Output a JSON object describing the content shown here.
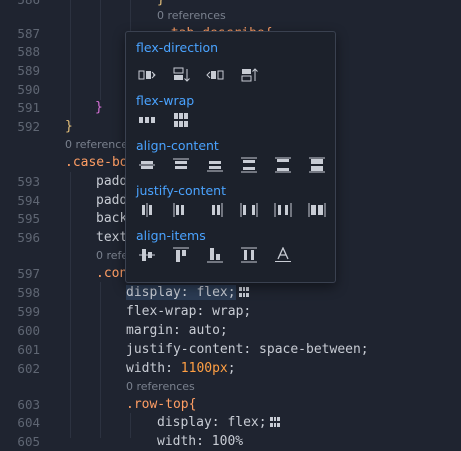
{
  "editor": {
    "lines": [
      {
        "n": "586",
        "code": "}",
        "partial": true
      },
      {
        "n": "",
        "ref": "0 references"
      },
      {
        "n": "587",
        "code": ".tab-describe{"
      },
      {
        "n": "588",
        "code": ""
      },
      {
        "n": "589",
        "code": ""
      },
      {
        "n": "590",
        "code": ""
      },
      {
        "n": "591",
        "code": "}"
      },
      {
        "n": "592",
        "code": "}"
      },
      {
        "n": "",
        "ref": "0 references"
      },
      {
        "n": "",
        "code": ".case-bo"
      },
      {
        "n": "593",
        "code": "padd"
      },
      {
        "n": "594",
        "code": "padd"
      },
      {
        "n": "595",
        "code": "back"
      },
      {
        "n": "596",
        "code": "text"
      },
      {
        "n": "",
        "ref": "0 refe"
      },
      {
        "n": "597",
        "code": ".con"
      },
      {
        "n": "598",
        "code": "display: flex;"
      },
      {
        "n": "599",
        "code": "flex-wrap: wrap;"
      },
      {
        "n": "600",
        "code": "margin: auto;"
      },
      {
        "n": "601",
        "code": "justify-content: space-between;"
      },
      {
        "n": "602",
        "code_pre": "width: ",
        "num": "1100px",
        "code_post": ";"
      },
      {
        "n": "603",
        "code": ""
      },
      {
        "n": "",
        "ref": "0 references"
      },
      {
        "n": "604",
        "code": ".row-top{"
      },
      {
        "n": "605",
        "code": "display: flex;"
      }
    ],
    "line_numbers": [
      "586",
      "587",
      "588",
      "589",
      "590",
      "591",
      "592",
      "593",
      "594",
      "595",
      "596",
      "597",
      "598",
      "599",
      "600",
      "601",
      "602",
      "603",
      "604",
      "605"
    ],
    "refs_label": "0 references",
    "ref_short": "0 refe",
    "c592": "}",
    "c591": "}",
    "c593": ".case-bo",
    "c594": "padd",
    "c595": "padd",
    "c596": "back",
    "c597": "text",
    "c598": ".con",
    "c599": "display: flex;",
    "c600": "flex-wrap: wrap;",
    "c601": "margin: auto;",
    "c602": "justify-content: space-between;",
    "c603_pre": "width: ",
    "c603_num": "1100px",
    "c603_post": ";",
    "c604": ".row-top{",
    "c605": "display: flex;",
    "c587": ".tab-describe{",
    "c606": "width: 100%"
  },
  "popup": {
    "sections": [
      {
        "title": "flex-direction",
        "icons": [
          "flex-direction-row-icon",
          "flex-direction-column-icon",
          "flex-direction-row-reverse-icon",
          "flex-direction-column-reverse-icon"
        ]
      },
      {
        "title": "flex-wrap",
        "icons": [
          "flex-wrap-nowrap-icon",
          "flex-wrap-wrap-icon"
        ]
      },
      {
        "title": "align-content",
        "icons": [
          "align-content-center-icon",
          "align-content-start-icon",
          "align-content-end-icon",
          "align-content-space-around-icon",
          "align-content-space-between-icon",
          "align-content-stretch-icon"
        ]
      },
      {
        "title": "justify-content",
        "icons": [
          "justify-content-center-icon",
          "justify-content-start-icon",
          "justify-content-end-icon",
          "justify-content-space-between-icon",
          "justify-content-space-around-icon",
          "justify-content-space-evenly-icon"
        ]
      },
      {
        "title": "align-items",
        "icons": [
          "align-items-center-icon",
          "align-items-start-icon",
          "align-items-end-icon",
          "align-items-stretch-icon",
          "align-items-baseline-icon"
        ]
      }
    ]
  },
  "colors": {
    "background": "#1f2430",
    "selector": "#ff9e64",
    "accent_blue": "#4aa3ff",
    "number": "#ff9f43",
    "brace": "#e5c07b"
  }
}
